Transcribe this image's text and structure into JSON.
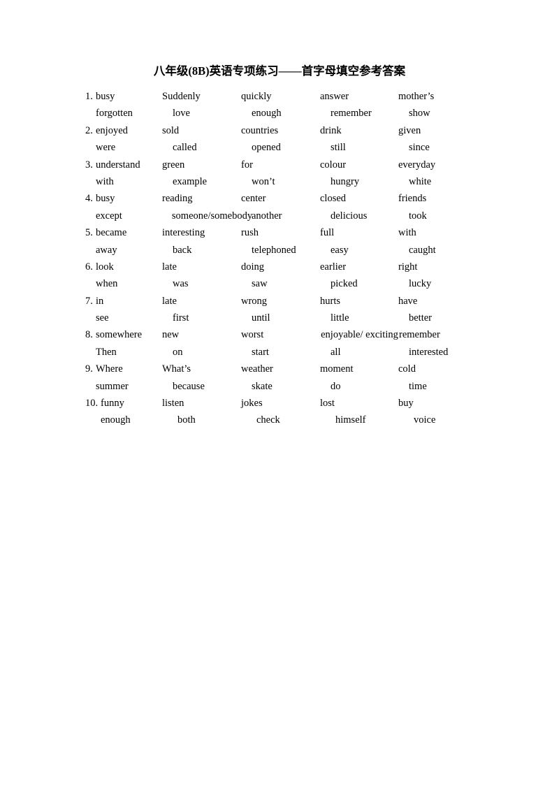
{
  "document": {
    "title": "八年级(8B)英语专项练习——首字母填空参考答案",
    "background_color": "#ffffff",
    "text_color": "#000000"
  },
  "answers": [
    {
      "number": "1.",
      "line_a": [
        "busy",
        "Suddenly",
        "quickly",
        "answer",
        "mother’s"
      ],
      "line_b": [
        "forgotten",
        "love",
        "enough",
        "remember",
        "show"
      ]
    },
    {
      "number": "2.",
      "line_a": [
        "enjoyed",
        "sold",
        "countries",
        "drink",
        "given"
      ],
      "line_b": [
        "were",
        "called",
        "opened",
        "still",
        "since"
      ]
    },
    {
      "number": "3.",
      "line_a": [
        "understand",
        "green",
        "for",
        "colour",
        "everyday"
      ],
      "line_b": [
        "with",
        "example",
        "won’t",
        "hungry",
        "white"
      ]
    },
    {
      "number": "4.",
      "line_a": [
        "busy",
        "reading",
        "center",
        "closed",
        "friends"
      ],
      "line_b": [
        "except",
        "someone/somebody",
        "another",
        "delicious",
        "took"
      ]
    },
    {
      "number": "5.",
      "line_a": [
        "became",
        "interesting",
        "rush",
        "full",
        "with"
      ],
      "line_b": [
        "away",
        "back",
        "telephoned",
        "easy",
        "caught"
      ]
    },
    {
      "number": "6.",
      "line_a": [
        "look",
        "late",
        "doing",
        "earlier",
        "right"
      ],
      "line_b": [
        "when",
        "was",
        "saw",
        "picked",
        "lucky"
      ]
    },
    {
      "number": "7.",
      "line_a": [
        "in",
        "late",
        "wrong",
        "hurts",
        "have"
      ],
      "line_b": [
        "see",
        "first",
        "until",
        "little",
        "better"
      ]
    },
    {
      "number": "8.",
      "line_a": [
        "somewhere",
        "new",
        "worst",
        "enjoyable/ exciting",
        "remember"
      ],
      "line_b": [
        "Then",
        "on",
        "start",
        "all",
        "interested"
      ]
    },
    {
      "number": "9.",
      "line_a": [
        "Where",
        "What’s",
        "weather",
        "moment",
        "cold"
      ],
      "line_b": [
        "summer",
        "because",
        "skate",
        "do",
        "time"
      ]
    },
    {
      "number": "10.",
      "line_a": [
        "funny",
        "listen",
        "jokes",
        "lost",
        "buy"
      ],
      "line_b": [
        "enough",
        "both",
        "check",
        "himself",
        "voice"
      ]
    }
  ]
}
